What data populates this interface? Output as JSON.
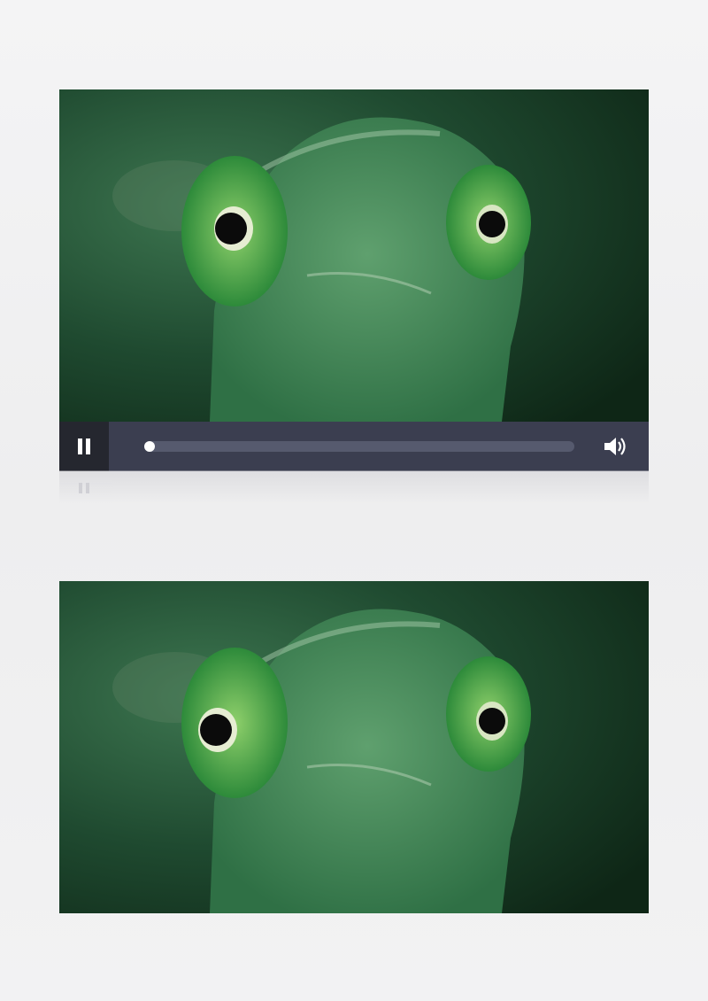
{
  "player": {
    "state": "paused-button-shown",
    "progress": 0.0,
    "controls": {
      "play_pause_icon": "pause-icon",
      "volume_icon": "volume-icon"
    },
    "colors": {
      "control_bar": "#3b3e50",
      "play_button_bg": "#25272f",
      "track": "#565a6e",
      "knob": "#ffffff"
    }
  },
  "frames": [
    {
      "subject": "chameleon-closeup"
    },
    {
      "subject": "chameleon-closeup"
    }
  ]
}
